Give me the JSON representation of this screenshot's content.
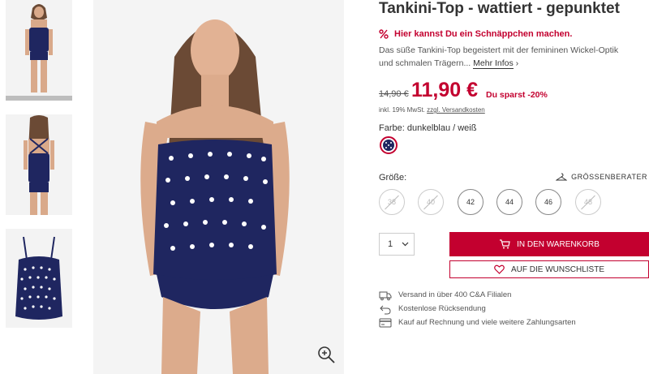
{
  "product": {
    "title": "Tankini-Top - wattiert - gepunktet",
    "deal_text": "Hier kannst Du ein Schnäppchen machen.",
    "description": "Das süße Tankini-Top begeistert mit der femininen Wickel-Optik und schmalen Trägern...",
    "more_info_label": "Mehr Infos",
    "old_price": "14,90 €",
    "new_price": "11,90 €",
    "savings": "Du sparst -20%",
    "vat_text": "inkl. 19% MwSt.",
    "shipping_link": "zzgl. Versandkosten",
    "color_label": "Farbe: dunkelblau / weiß",
    "size_label": "Größe:",
    "size_guide_label": "GRÖSSENBERATER",
    "sizes": [
      {
        "label": "38",
        "available": false
      },
      {
        "label": "40",
        "available": false
      },
      {
        "label": "42",
        "available": true
      },
      {
        "label": "44",
        "available": true
      },
      {
        "label": "46",
        "available": true
      },
      {
        "label": "48",
        "available": false
      }
    ],
    "quantity": "1",
    "add_to_cart_label": "IN DEN WARENKORB",
    "wishlist_label": "AUF DIE WUNSCHLISTE",
    "benefits": [
      {
        "icon": "truck-icon",
        "text": "Versand in über 400 C&A Filialen"
      },
      {
        "icon": "return-arrow-icon",
        "text": "Kostenlose Rücksendung"
      },
      {
        "icon": "credit-card-icon",
        "text": "Kauf auf Rechnung und viele weitere Zahlungsarten"
      }
    ]
  },
  "colors": {
    "accent": "#c3002f",
    "swatch": "#1f2660"
  }
}
